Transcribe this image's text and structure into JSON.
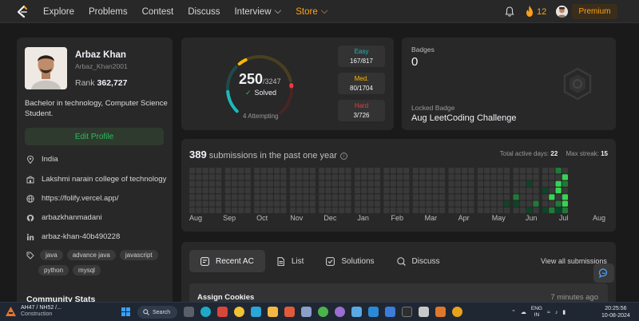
{
  "nav": {
    "links": [
      "Explore",
      "Problems",
      "Contest",
      "Discuss",
      "Interview",
      "Store"
    ],
    "streak_count": "12",
    "premium_label": "Premium"
  },
  "profile": {
    "name": "Arbaz Khan",
    "handle": "Arbaz_Khan2001",
    "rank_label": "Rank",
    "rank_value": "362,727",
    "bio": "Bachelor in technology, Computer Science Student.",
    "edit_label": "Edit Profile",
    "location": "India",
    "college": "Lakshmi narain college of technology",
    "website": "https://folify.vercel.app/",
    "github": "arbazkhanmadani",
    "linkedin": "arbaz-khan-40b490228",
    "skills": [
      "java",
      "advance java",
      "javascript",
      "python",
      "mysql"
    ],
    "community_title": "Community Stats"
  },
  "solved": {
    "count": "250",
    "total": "/3247",
    "label": "Solved",
    "attempting": "4 Attempting",
    "progress": {
      "easy": 0.204,
      "medium": 0.047,
      "hard": 0.004
    },
    "difficulties": [
      {
        "label": "Easy",
        "value": "167/817",
        "color": "#1cbaba"
      },
      {
        "label": "Med.",
        "value": "80/1704",
        "color": "#ffb700"
      },
      {
        "label": "Hard",
        "value": "3/726",
        "color": "#f63737"
      }
    ]
  },
  "badges": {
    "title": "Badges",
    "count": "0",
    "locked_label": "Locked Badge",
    "locked_name": "Aug LeetCoding Challenge"
  },
  "submissions": {
    "count": "389",
    "text": "submissions in the past one year",
    "active_label": "Total active days:",
    "active_value": "22",
    "streak_label": "Max streak:",
    "streak_value": "15",
    "months": [
      "Aug",
      "Sep",
      "Oct",
      "Nov",
      "Dec",
      "Jan",
      "Feb",
      "Mar",
      "Apr",
      "May",
      "Jun",
      "Jul",
      "Aug"
    ]
  },
  "activity": {
    "tabs": [
      "Recent AC",
      "List",
      "Solutions",
      "Discuss"
    ],
    "view_all": "View all submissions",
    "recent": [
      {
        "title": "Assign Cookies",
        "time": "7 minutes ago"
      }
    ]
  },
  "taskbar": {
    "news_title": "AH47 / NH52 /...",
    "news_sub": "Construction",
    "search_label": "Search",
    "lang1": "ENG",
    "lang2": "IN",
    "time": "20:25:56",
    "date": "10-08-2024"
  },
  "colors": {
    "accent": "#ffa116",
    "green": "#2cbb5d",
    "card": "#282828",
    "bg": "#1a1a1a"
  }
}
